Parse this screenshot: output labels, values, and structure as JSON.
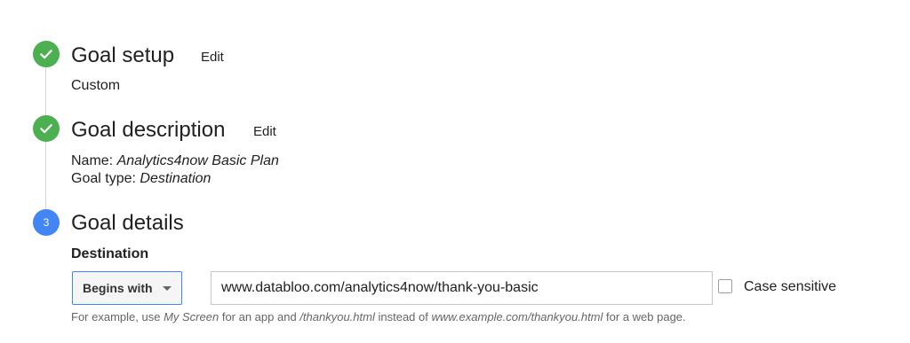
{
  "steps": [
    {
      "state": "complete",
      "icon": "checkmark-icon",
      "title": "Goal setup",
      "edit_label": "Edit",
      "detail": "Custom"
    },
    {
      "state": "complete",
      "icon": "checkmark-icon",
      "title": "Goal description",
      "edit_label": "Edit",
      "name_label": "Name:",
      "name_value": "Analytics4now Basic Plan",
      "type_label": "Goal type:",
      "type_value": "Destination"
    },
    {
      "state": "current",
      "number": "3",
      "title": "Goal details"
    }
  ],
  "destination": {
    "section_label": "Destination",
    "match_type": {
      "selected": "Begins with",
      "icon": "caret-down-icon"
    },
    "url_value": "www.databloo.com/analytics4now/thank-you-basic",
    "case_sensitive_label": "Case sensitive",
    "case_sensitive_checked": false,
    "help": {
      "t1": "For example, use",
      "e1": "My Screen",
      "t2": "for an app and",
      "e2": "/thankyou.html",
      "t3": "instead of",
      "e3": "www.example.com/thankyou.html",
      "t4": "for a web page."
    }
  },
  "colors": {
    "complete": "#4caf50",
    "current": "#4285f4",
    "select_border": "#4285f4",
    "rail": "#d6d6d6"
  }
}
